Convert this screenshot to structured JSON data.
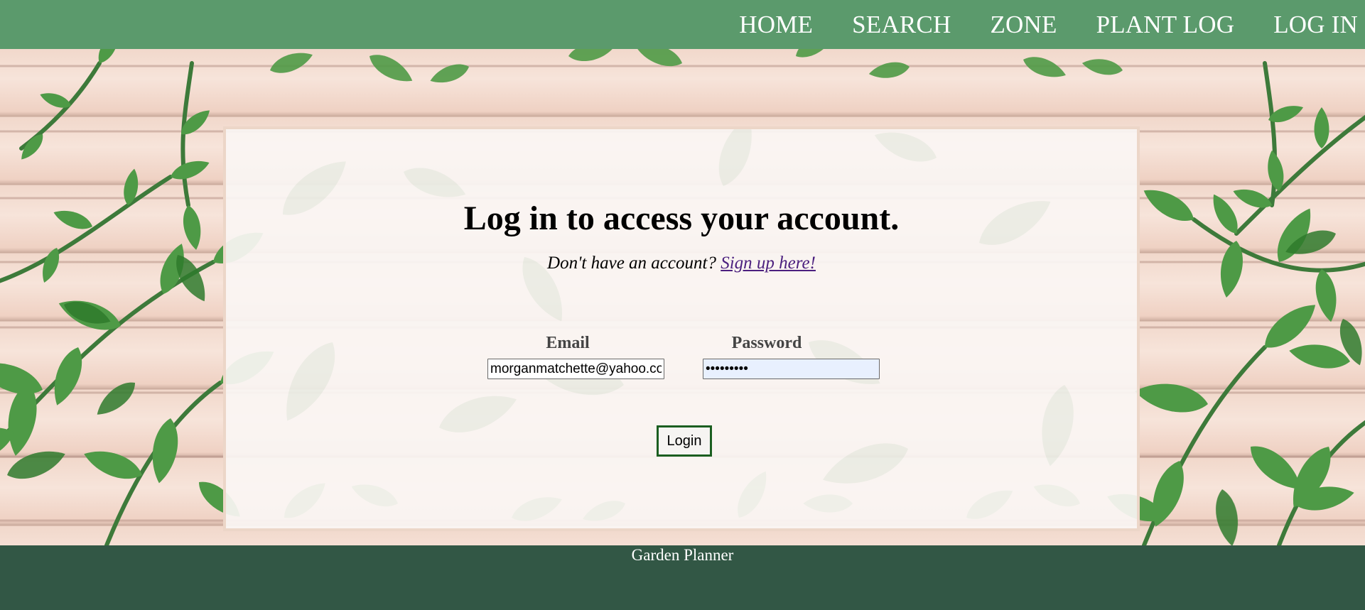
{
  "nav": {
    "items": [
      "HOME",
      "SEARCH",
      "ZONE",
      "PLANT LOG",
      "LOG IN"
    ]
  },
  "login": {
    "title": "Log in to access your account.",
    "signup_prompt": "Don't have an account?",
    "signup_link": "Sign up here!",
    "email_label": "Email",
    "email_value": "morganmatchette@yahoo.com",
    "password_label": "Password",
    "password_value": "•••••••••",
    "login_button": "Login"
  },
  "footer": {
    "text": "Garden Planner"
  },
  "colors": {
    "nav_bg": "#5b9a6c",
    "footer_bg": "#325745",
    "login_border": "#1b5e20",
    "link": "#4b1f7e"
  }
}
